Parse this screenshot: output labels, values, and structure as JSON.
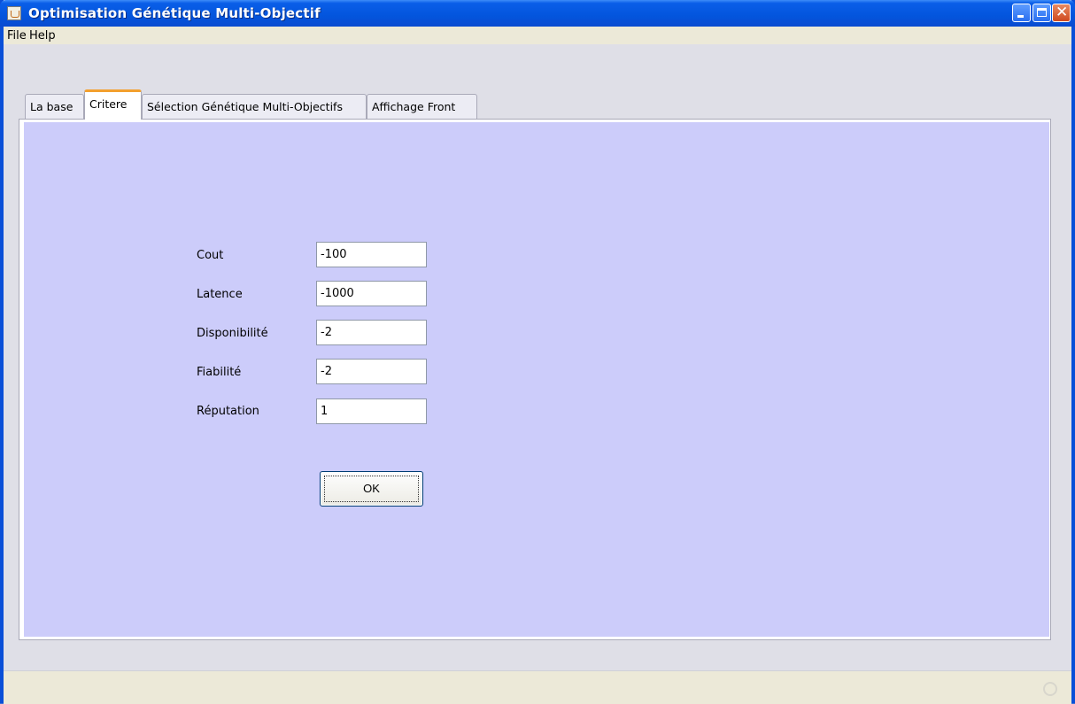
{
  "window": {
    "title": "Optimisation Génétique Multi-Objectif",
    "icon": "java-cup-icon",
    "controls": {
      "minimize": "minimize-icon",
      "maximize": "maximize-icon",
      "close": "close-icon"
    }
  },
  "menubar": {
    "items": [
      "File",
      "Help"
    ]
  },
  "tabs": [
    {
      "label": "La base",
      "active": false
    },
    {
      "label": "Critere",
      "active": true
    },
    {
      "label": "Sélection Génétique Multi-Objectifs",
      "active": false
    },
    {
      "label": "Affichage Front",
      "active": false
    }
  ],
  "form": {
    "fields": [
      {
        "label": "Cout",
        "value": "-100"
      },
      {
        "label": "Latence",
        "value": "-1000"
      },
      {
        "label": "Disponibilité",
        "value": "-2"
      },
      {
        "label": "Fiabilité",
        "value": "-2"
      },
      {
        "label": "Réputation",
        "value": "1"
      }
    ],
    "ok_label": "OK"
  },
  "colors": {
    "panel": "#ccccfa",
    "active_tab_accent": "#f3a02e",
    "titlebar": "#0355dd"
  }
}
